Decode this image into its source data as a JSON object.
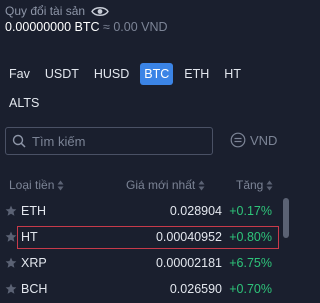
{
  "asset": {
    "title": "Quy đổi tài sản",
    "btc_value": "0.00000000 BTC",
    "approx": "≈ 0.00 VND"
  },
  "tabs": [
    "Fav",
    "USDT",
    "HUSD",
    "BTC",
    "ETH",
    "HT",
    "ALTS"
  ],
  "active_tab": "BTC",
  "search": {
    "placeholder": "Tìm kiếm"
  },
  "currency_toggle": "VND",
  "table": {
    "headers": {
      "coin": "Loại tiền",
      "price": "Giá mới nhất",
      "change": "Tăng"
    },
    "rows": [
      {
        "coin": "ETH",
        "price": "0.028904",
        "change": "+0.17%"
      },
      {
        "coin": "HT",
        "price": "0.00040952",
        "change": "+0.80%"
      },
      {
        "coin": "XRP",
        "price": "0.00002181",
        "change": "+6.75%"
      },
      {
        "coin": "BCH",
        "price": "0.026590",
        "change": "+0.70%"
      }
    ],
    "selected_row": "HT"
  },
  "colors": {
    "background": "#1a1f2e",
    "accent": "#3b84e6",
    "positive": "#2ec47a",
    "selection_border": "#c73a4a"
  }
}
